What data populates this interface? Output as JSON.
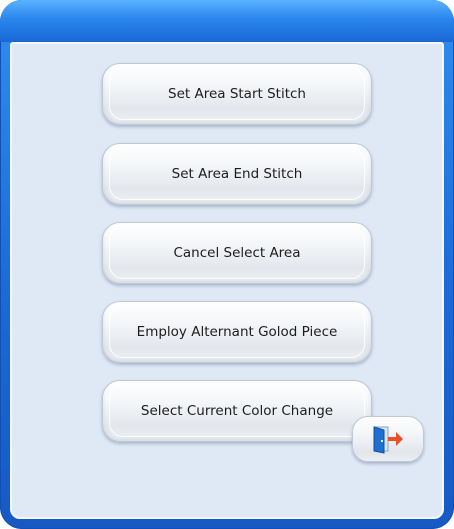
{
  "dialog": {
    "buttons": [
      {
        "label": "Set Area Start Stitch"
      },
      {
        "label": "Set Area End Stitch"
      },
      {
        "label": "Cancel Select Area"
      },
      {
        "label": "Employ Alternant Golod Piece"
      },
      {
        "label": "Select Current Color Change"
      }
    ],
    "exit_icon": "exit-door-icon"
  },
  "colors": {
    "frame": "#1b6ad8",
    "panel": "#dfe9f6",
    "exit_arrow": "#e8502a",
    "exit_door": "#1e6fd0"
  }
}
